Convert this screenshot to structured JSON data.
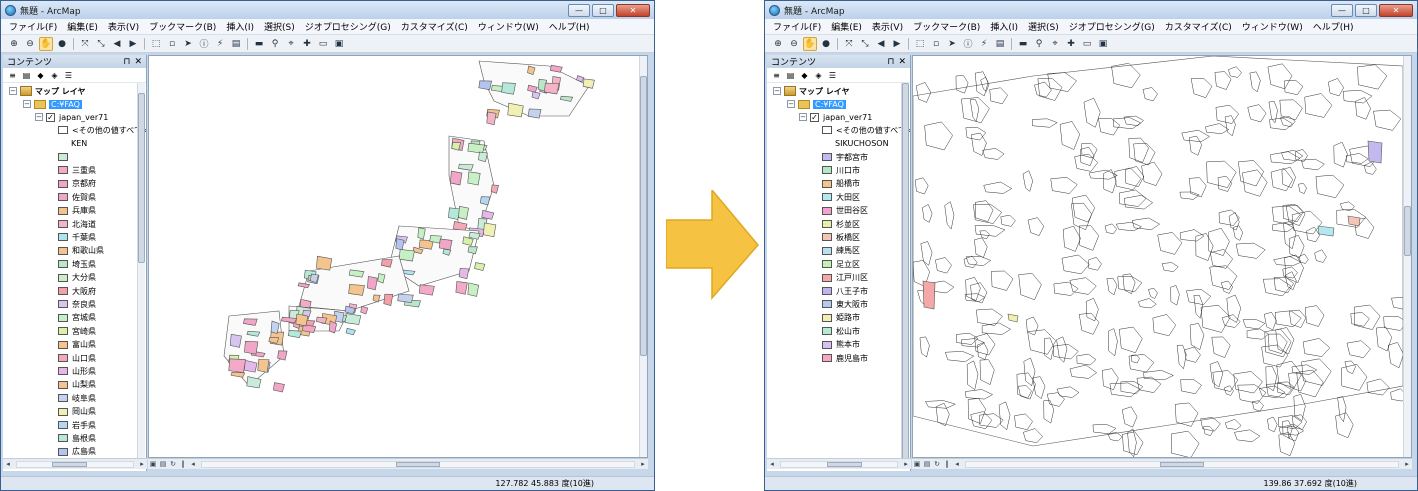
{
  "arrow_color": "#f5c242",
  "left_window": {
    "title": "無題 - ArcMap",
    "menu": [
      "ファイル(F)",
      "編集(E)",
      "表示(V)",
      "ブックマーク(B)",
      "挿入(I)",
      "選択(S)",
      "ジオプロセシング(G)",
      "カスタマイズ(C)",
      "ウィンドウ(W)",
      "ヘルプ(H)"
    ],
    "toc_title": "コンテンツ",
    "map_layers_label": "マップ レイヤ",
    "folder_label": "C:¥FAQ",
    "layer_name": "japan_ver71",
    "other_values_label": "<その他の値すべて>",
    "field_name": "KEN",
    "legend_items": [
      {
        "label": "",
        "color": "#c8ecd8"
      },
      {
        "label": "三重県",
        "color": "#f4a9c8"
      },
      {
        "label": "京都府",
        "color": "#f1a6c7"
      },
      {
        "label": "佐賀県",
        "color": "#f1a6c7"
      },
      {
        "label": "兵庫県",
        "color": "#f4c48e"
      },
      {
        "label": "北海道",
        "color": "#f3b4c7"
      },
      {
        "label": "千葉県",
        "color": "#aee3f0"
      },
      {
        "label": "和歌山県",
        "color": "#f4c48e"
      },
      {
        "label": "埼玉県",
        "color": "#bbe7c6"
      },
      {
        "label": "大分県",
        "color": "#c8f0c4"
      },
      {
        "label": "大阪府",
        "color": "#f4a0a8"
      },
      {
        "label": "奈良県",
        "color": "#d7c4f0"
      },
      {
        "label": "宮城県",
        "color": "#c4f0c4"
      },
      {
        "label": "宮崎県",
        "color": "#d8f0a8"
      },
      {
        "label": "富山県",
        "color": "#f4c48e"
      },
      {
        "label": "山口県",
        "color": "#f4a9b8"
      },
      {
        "label": "山形県",
        "color": "#e4b8e8"
      },
      {
        "label": "山梨県",
        "color": "#f4c48e"
      },
      {
        "label": "岐阜県",
        "color": "#c4d2f0"
      },
      {
        "label": "岡山県",
        "color": "#f0f0b4"
      },
      {
        "label": "岩手県",
        "color": "#b4d6f0"
      },
      {
        "label": "島根県",
        "color": "#b4e8d8"
      },
      {
        "label": "広島県",
        "color": "#b4c4f0"
      }
    ],
    "status": "127.782  45.883 度(10進)"
  },
  "right_window": {
    "title": "無題 - ArcMap",
    "menu": [
      "ファイル(F)",
      "編集(E)",
      "表示(V)",
      "ブックマーク(B)",
      "挿入(I)",
      "選択(S)",
      "ジオプロセシング(G)",
      "カスタマイズ(C)",
      "ウィンドウ(W)",
      "ヘルプ(H)"
    ],
    "toc_title": "コンテンツ",
    "map_layers_label": "マップ レイヤ",
    "folder_label": "C:¥FAQ",
    "layer_name": "japan_ver71",
    "other_values_label": "<その他の値すべて>",
    "field_name": "SIKUCHOSON",
    "legend_items": [
      {
        "label": "宇都宮市",
        "color": "#c4b8f0"
      },
      {
        "label": "川口市",
        "color": "#b4e8c4"
      },
      {
        "label": "船橋市",
        "color": "#f4c48e"
      },
      {
        "label": "大田区",
        "color": "#b4e8f0"
      },
      {
        "label": "世田谷区",
        "color": "#f4a0d0"
      },
      {
        "label": "杉並区",
        "color": "#e8f0a8"
      },
      {
        "label": "板橋区",
        "color": "#f4c4b4"
      },
      {
        "label": "練馬区",
        "color": "#b8e0f0"
      },
      {
        "label": "足立区",
        "color": "#c4f0b4"
      },
      {
        "label": "江戸川区",
        "color": "#f4a8a8"
      },
      {
        "label": "八王子市",
        "color": "#c0b4f0"
      },
      {
        "label": "東大阪市",
        "color": "#b4c8f0"
      },
      {
        "label": "姫路市",
        "color": "#f0f0b0"
      },
      {
        "label": "松山市",
        "color": "#b4ecd0"
      },
      {
        "label": "熊本市",
        "color": "#d8c0f0"
      },
      {
        "label": "鹿児島市",
        "color": "#f4a8c4"
      }
    ],
    "status": "139.86  37.692 度(10進)"
  }
}
